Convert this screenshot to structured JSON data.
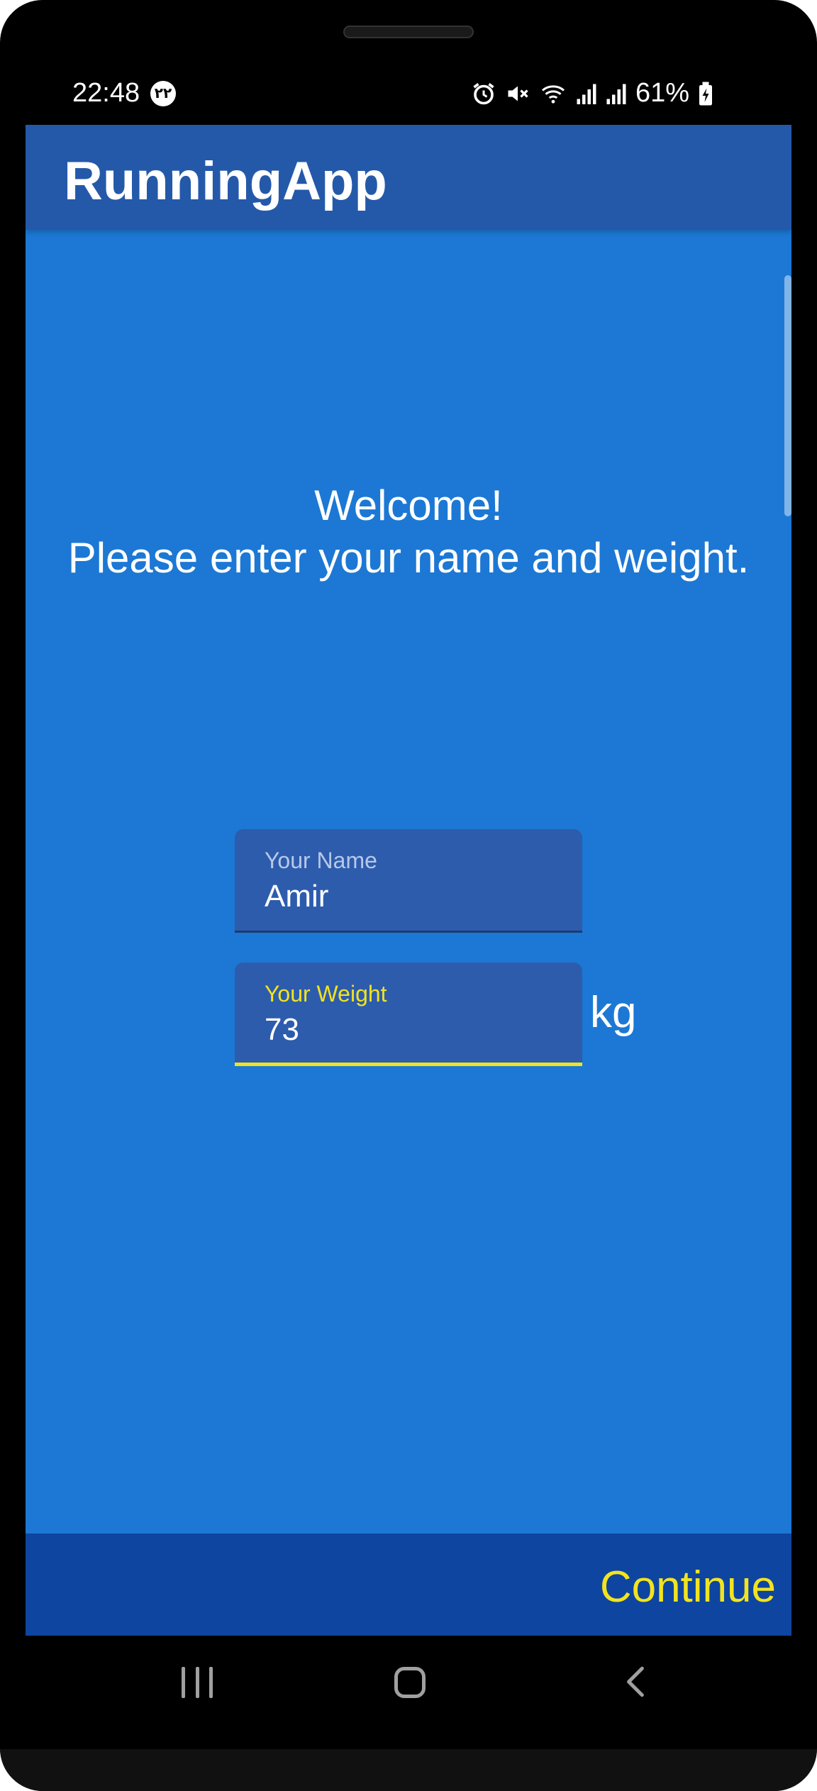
{
  "status_bar": {
    "time": "22:48",
    "notification_badge": "۲۲",
    "battery_percent": "61%",
    "icons": [
      "alarm-icon",
      "mute-icon",
      "wifi-icon",
      "signal-icon",
      "signal-icon",
      "battery-icon"
    ]
  },
  "app_bar": {
    "title": "RunningApp"
  },
  "welcome": {
    "line1": "Welcome!",
    "line2": "Please enter your name and weight."
  },
  "form": {
    "name_field": {
      "label": "Your Name",
      "value": "Amir"
    },
    "weight_field": {
      "label": "Your Weight",
      "value": "73",
      "unit": "kg"
    }
  },
  "bottom_bar": {
    "continue_label": "Continue"
  },
  "colors": {
    "screen_bg": "#1c78d4",
    "app_bar": "#2459aa",
    "bottom_bar": "#0d45a0",
    "accent": "#f2e31f",
    "field_bg": "#2d5cad"
  },
  "nav_bar": {
    "icons": [
      "recent-apps-icon",
      "home-icon",
      "back-icon"
    ]
  }
}
